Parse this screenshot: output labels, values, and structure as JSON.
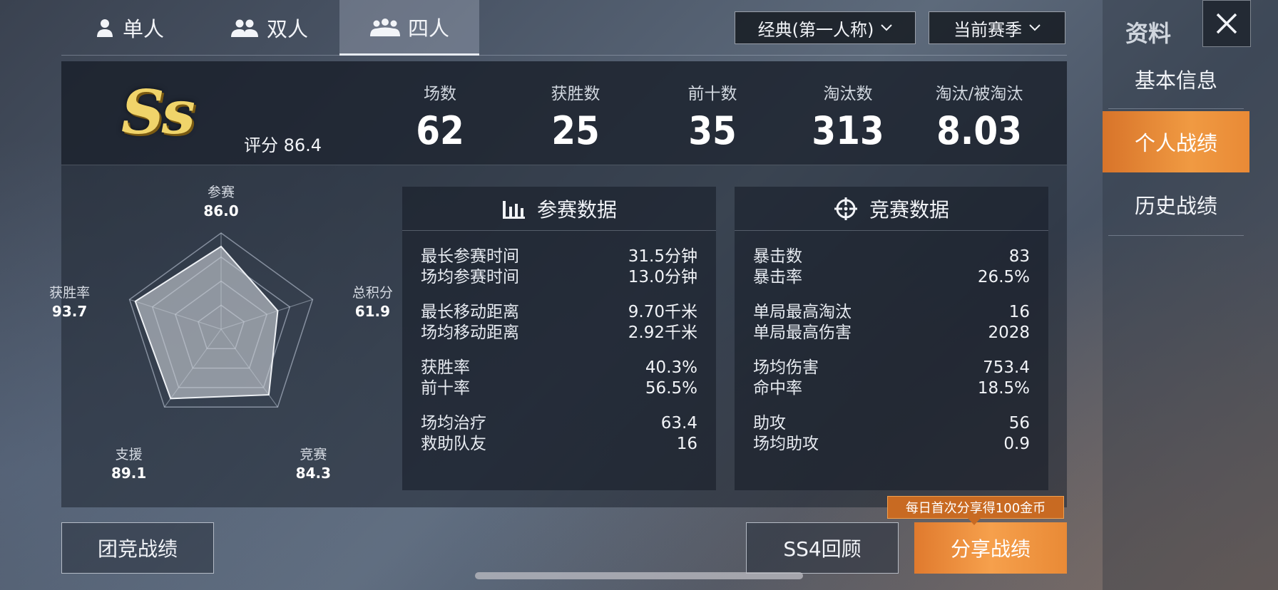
{
  "tabs": [
    {
      "label": "单人",
      "icon": "single-person-icon",
      "active": false
    },
    {
      "label": "双人",
      "icon": "duo-icon",
      "active": false
    },
    {
      "label": "四人",
      "icon": "squad-icon",
      "active": true
    }
  ],
  "filters": {
    "mode": "经典(第一人称)",
    "season": "当前赛季"
  },
  "sidebar": {
    "title": "资料",
    "items": [
      {
        "label": "基本信息",
        "active": false
      },
      {
        "label": "个人战绩",
        "active": true
      },
      {
        "label": "历史战绩",
        "active": false
      }
    ]
  },
  "summary": {
    "rank": "Ss",
    "score_label": "评分 86.4",
    "stats": [
      {
        "label": "场数",
        "value": "62"
      },
      {
        "label": "获胜数",
        "value": "25"
      },
      {
        "label": "前十数",
        "value": "35"
      },
      {
        "label": "淘汰数",
        "value": "313"
      },
      {
        "label": "淘汰/被淘汰",
        "value": "8.03"
      }
    ]
  },
  "radar": {
    "axes": [
      {
        "label": "参赛",
        "value": "86.0",
        "score": 86.0
      },
      {
        "label": "总积分",
        "value": "61.9",
        "score": 61.9
      },
      {
        "label": "竞赛",
        "value": "84.3",
        "score": 84.3
      },
      {
        "label": "支援",
        "value": "89.1",
        "score": 89.1
      },
      {
        "label": "获胜率",
        "value": "93.7",
        "score": 93.7
      }
    ],
    "max": 100
  },
  "participation": {
    "title": "参赛数据",
    "icon": "bar-chart-icon",
    "groups": [
      [
        {
          "label": "最长参赛时间",
          "value": "31.5分钟"
        },
        {
          "label": "场均参赛时间",
          "value": "13.0分钟"
        }
      ],
      [
        {
          "label": "最长移动距离",
          "value": "9.70千米"
        },
        {
          "label": "场均移动距离",
          "value": "2.92千米"
        }
      ],
      [
        {
          "label": "获胜率",
          "value": "40.3%"
        },
        {
          "label": "前十率",
          "value": "56.5%"
        }
      ],
      [
        {
          "label": "场均治疗",
          "value": "63.4"
        },
        {
          "label": "救助队友",
          "value": "16"
        }
      ]
    ]
  },
  "competition": {
    "title": "竞赛数据",
    "icon": "crosshair-icon",
    "groups": [
      [
        {
          "label": "暴击数",
          "value": "83"
        },
        {
          "label": "暴击率",
          "value": "26.5%"
        }
      ],
      [
        {
          "label": "单局最高淘汰",
          "value": "16"
        },
        {
          "label": "单局最高伤害",
          "value": "2028"
        }
      ],
      [
        {
          "label": "场均伤害",
          "value": "753.4"
        },
        {
          "label": "命中率",
          "value": "18.5%"
        }
      ],
      [
        {
          "label": "助攻",
          "value": "56"
        },
        {
          "label": "场均助攻",
          "value": "0.9"
        }
      ]
    ]
  },
  "bottom": {
    "team_btn": "团竞战绩",
    "review_btn": "SS4回顾",
    "share_btn": "分享战绩",
    "tip": "每日首次分享得100金币"
  }
}
